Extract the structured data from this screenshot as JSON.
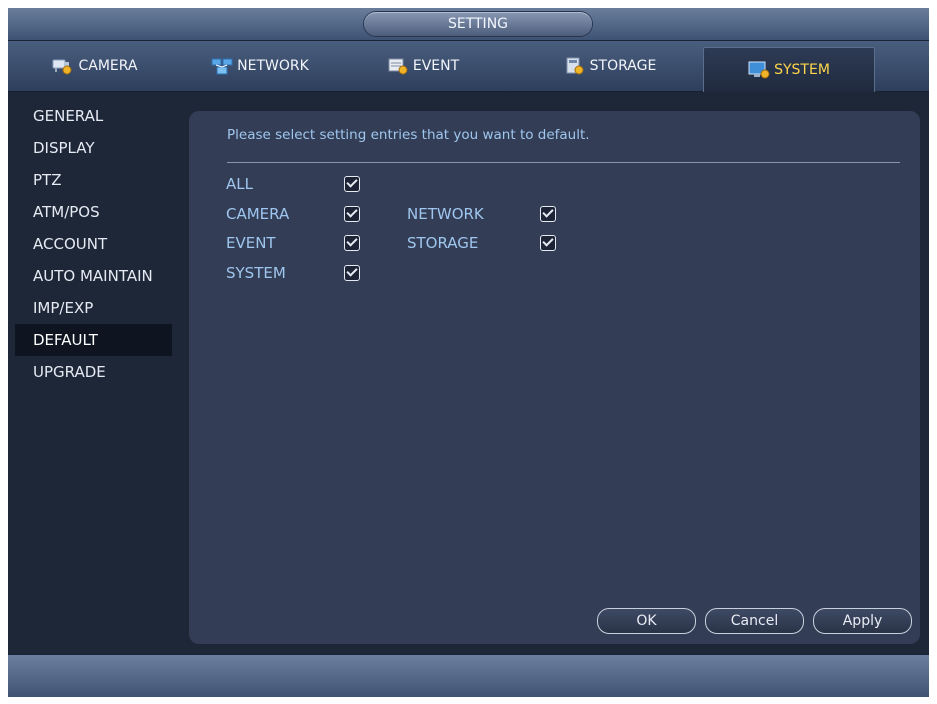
{
  "window": {
    "title": "SETTING"
  },
  "tabs": [
    {
      "label": "CAMERA",
      "icon": "camera-icon"
    },
    {
      "label": "NETWORK",
      "icon": "network-icon"
    },
    {
      "label": "EVENT",
      "icon": "event-icon"
    },
    {
      "label": "STORAGE",
      "icon": "storage-icon"
    },
    {
      "label": "SYSTEM",
      "icon": "system-icon",
      "active": true
    }
  ],
  "sidebar": {
    "items": [
      {
        "label": "GENERAL"
      },
      {
        "label": "DISPLAY"
      },
      {
        "label": "PTZ"
      },
      {
        "label": "ATM/POS"
      },
      {
        "label": "ACCOUNT"
      },
      {
        "label": "AUTO MAINTAIN"
      },
      {
        "label": "IMP/EXP"
      },
      {
        "label": "DEFAULT",
        "active": true
      },
      {
        "label": "UPGRADE"
      }
    ]
  },
  "main": {
    "prompt": "Please select setting entries that you want to default.",
    "options": [
      {
        "label": "ALL",
        "checked": true
      },
      {
        "label": "CAMERA",
        "checked": true
      },
      {
        "label": "NETWORK",
        "checked": true
      },
      {
        "label": "EVENT",
        "checked": true
      },
      {
        "label": "STORAGE",
        "checked": true
      },
      {
        "label": "SYSTEM",
        "checked": true
      }
    ],
    "buttons": {
      "ok": "OK",
      "cancel": "Cancel",
      "apply": "Apply"
    }
  },
  "colors": {
    "accent_active_tab": "#ffd54a",
    "label_text": "#9fc6ee",
    "panel_bg": "#333e56",
    "window_bg": "#1e2738"
  }
}
